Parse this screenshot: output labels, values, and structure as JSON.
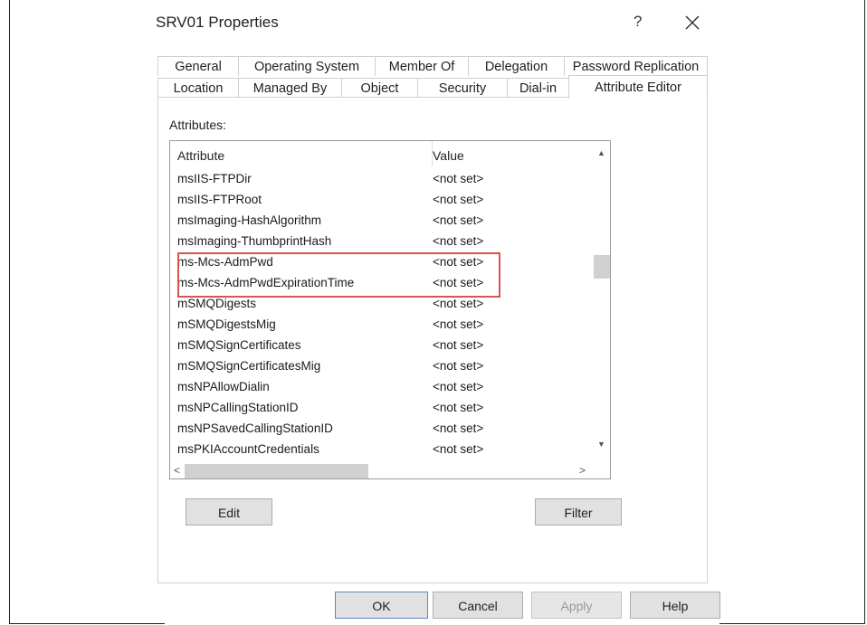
{
  "window": {
    "title": "SRV01 Properties",
    "help_label": "?",
    "close_icon": "close-icon"
  },
  "tabs_row1": [
    "General",
    "Operating System",
    "Member Of",
    "Delegation",
    "Password Replication"
  ],
  "tabs_row2": [
    "Location",
    "Managed By",
    "Object",
    "Security",
    "Dial-in",
    "Attribute Editor"
  ],
  "active_tab": "Attribute Editor",
  "attributes_label": "Attributes:",
  "list": {
    "col_attribute": "Attribute",
    "col_value": "Value",
    "rows": [
      {
        "attr": "msIIS-FTPDir",
        "value": "<not set>"
      },
      {
        "attr": "msIIS-FTPRoot",
        "value": "<not set>"
      },
      {
        "attr": "msImaging-HashAlgorithm",
        "value": "<not set>"
      },
      {
        "attr": "msImaging-ThumbprintHash",
        "value": "<not set>"
      },
      {
        "attr": "ms-Mcs-AdmPwd",
        "value": "<not set>"
      },
      {
        "attr": "ms-Mcs-AdmPwdExpirationTime",
        "value": "<not set>"
      },
      {
        "attr": "mSMQDigests",
        "value": "<not set>"
      },
      {
        "attr": "mSMQDigestsMig",
        "value": "<not set>"
      },
      {
        "attr": "mSMQSignCertificates",
        "value": "<not set>"
      },
      {
        "attr": "mSMQSignCertificatesMig",
        "value": "<not set>"
      },
      {
        "attr": "msNPAllowDialin",
        "value": "<not set>"
      },
      {
        "attr": "msNPCallingStationID",
        "value": "<not set>"
      },
      {
        "attr": "msNPSavedCallingStationID",
        "value": "<not set>"
      },
      {
        "attr": "msPKIAccountCredentials",
        "value": "<not set>"
      }
    ],
    "highlighted_rows": [
      "ms-Mcs-AdmPwd",
      "ms-Mcs-AdmPwdExpirationTime"
    ],
    "highlight_color": "#d9534f"
  },
  "buttons": {
    "edit": "Edit",
    "filter": "Filter",
    "ok": "OK",
    "cancel": "Cancel",
    "apply": "Apply",
    "help": "Help"
  },
  "icons": {
    "scroll_up": "▲",
    "scroll_down": "▼",
    "scroll_left": "<",
    "scroll_right": ">"
  }
}
